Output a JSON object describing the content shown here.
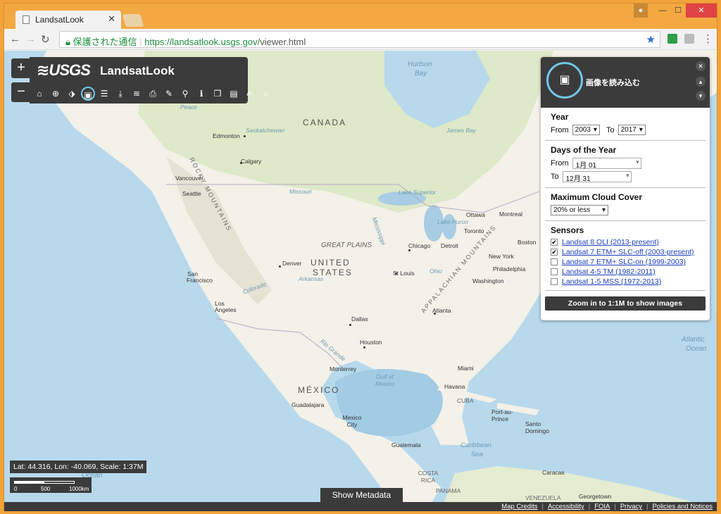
{
  "browser": {
    "tab_title": "LandsatLook",
    "secure_label": "保護された通信",
    "url_host": "https://landsatlook.usgs.gov",
    "url_path": "/viewer.html"
  },
  "app": {
    "usgs_logo": "≋USGS",
    "title": "LandsatLook",
    "zoom_in": "+",
    "zoom_out": "−"
  },
  "panel": {
    "title": "画像を読み込む",
    "year": {
      "label": "Year",
      "from_label": "From",
      "from_value": "2003",
      "to_label": "To",
      "to_value": "2017"
    },
    "days": {
      "label": "Days of the Year",
      "from_label": "From",
      "from_value": "1月 01",
      "to_label": "To",
      "to_value": "12月 31"
    },
    "cloud": {
      "label": "Maximum Cloud Cover",
      "value": "20% or less"
    },
    "sensors": {
      "label": "Sensors",
      "items": [
        {
          "label": "Landsat 8 OLI (2013-present)",
          "checked": "✔"
        },
        {
          "label": "Landsat 7 ETM+ SLC-off (2003-present)",
          "checked": "✔"
        },
        {
          "label": "Landsat 7 ETM+ SLC-on (1999-2003)",
          "checked": ""
        },
        {
          "label": "Landsat 4-5 TM (1982-2011)",
          "checked": ""
        },
        {
          "label": "Landsat 1-5 MSS (1972-2013)",
          "checked": ""
        }
      ]
    },
    "zoom_button": "Zoom in to 1:1M to show images"
  },
  "map": {
    "labels": {
      "canada": "CANADA",
      "us1": "UNITED",
      "us2": "STATES",
      "mexico": "MÉXICO",
      "great_plains": "GREAT PLAINS",
      "rocky": "ROCKY MOUNTAINS",
      "appalachian": "APPALACHIAN MOUNTAINS",
      "hudson": "Hudson",
      "bay": "Bay",
      "atlantic": "Atlantic",
      "ocean": "Ocean",
      "gulf": "Gulf of",
      "mexico_w": "Mexico",
      "caribbean": "Caribbean",
      "sea": "Sea",
      "edmonton": "Edmonton",
      "calgary": "Calgary",
      "vancouver": "Vancouver",
      "seattle": "Seattle",
      "sf1": "San",
      "sf2": "Francisco",
      "la1": "Los",
      "la2": "Angeles",
      "denver": "Denver",
      "dallas": "Dallas",
      "houston": "Houston",
      "chicago": "Chicago",
      "detroit": "Detroit",
      "stlouis": "St Louis",
      "toronto": "Toronto",
      "ottawa": "Ottawa",
      "montreal": "Montreal",
      "boston": "Boston",
      "newyork": "New York",
      "philly": "Philadelphia",
      "washington": "Washington",
      "atlanta": "Atlanta",
      "miami": "Miami",
      "havana": "Havana",
      "cuba": "CUBA",
      "monterrey": "Monterrey",
      "guadalajara": "Guadalajara",
      "mexico_city": "Mexico City",
      "guatemala": "Guatemala",
      "costa_rica": "COSTA RICA",
      "panama": "PANAMA",
      "caracas": "Caracas",
      "venezuela": "VENEZUELA",
      "georgetown": "Georgetown",
      "port_au_prince": "Port-au-Prince",
      "santo_domingo": "Santo Domingo",
      "missouri": "Missouri",
      "arkansas": "Arkansas",
      "colorado": "Colorado",
      "rio_grande": "Rio Grande",
      "mississippi": "Mississippi",
      "ohio": "Ohio",
      "saskatchewan": "Saskatchewan",
      "peace": "Peace",
      "lake_superior": "Lake Superior",
      "lake_huron": "Lake Huron",
      "james_bay": "James Bay",
      "ocean_w": "Ocean"
    }
  },
  "status": {
    "coords": "Lat: 44.316, Lon: -40.069, Scale: 1:37M",
    "scale_0": "0",
    "scale_500": "500",
    "scale_1000": "1000km"
  },
  "metadata_button": "Show Metadata",
  "footer": {
    "links": [
      "Map Credits",
      "Accessibility",
      "FOIA",
      "Privacy",
      "Policies and Notices"
    ]
  }
}
